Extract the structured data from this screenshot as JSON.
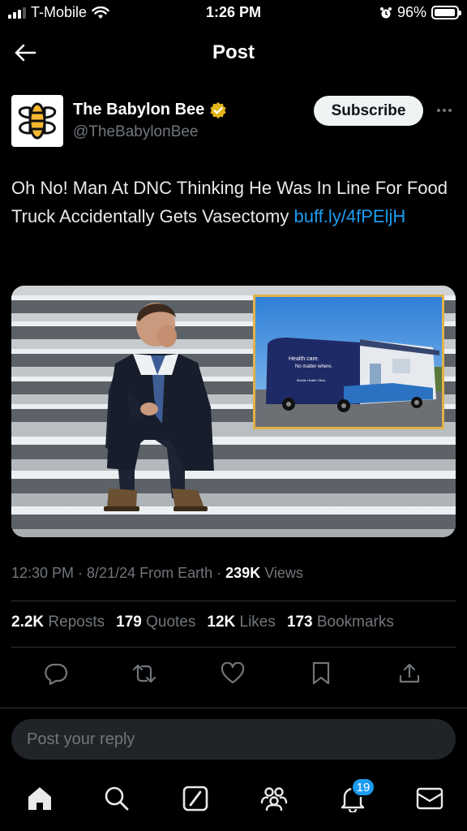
{
  "status_bar": {
    "carrier": "T-Mobile",
    "time": "1:26 PM",
    "battery": "96%",
    "battery_level": 0.96
  },
  "header": {
    "title": "Post"
  },
  "author": {
    "display_name": "The Babylon Bee",
    "handle": "@TheBabylonBee",
    "verified": true,
    "subscribe_label": "Subscribe"
  },
  "tweet": {
    "text": "Oh No! Man At DNC Thinking He Was In Line For Food Truck Accidentally Gets Vasectomy ",
    "link": "buff.ly/​4fPEljH",
    "media_inset": {
      "line1": "Health care.",
      "line2": "No matter where.",
      "line3": "Mobile Health Clinic"
    }
  },
  "meta": {
    "time": "12:30 PM",
    "date": "8/21/24",
    "source": "From Earth",
    "views_count": "239K",
    "views_label": "Views"
  },
  "stats": {
    "reposts_count": "2.2K",
    "reposts_label": "Reposts",
    "quotes_count": "179",
    "quotes_label": "Quotes",
    "likes_count": "12K",
    "likes_label": "Likes",
    "bookmarks_count": "173",
    "bookmarks_label": "Bookmarks"
  },
  "reply": {
    "placeholder": "Post your reply"
  },
  "tabbar": {
    "notifications_badge": "19"
  },
  "colors": {
    "accent": "#1d9bf0",
    "background": "#000000",
    "muted": "#71767b",
    "verified_gold": "#e2b719"
  }
}
